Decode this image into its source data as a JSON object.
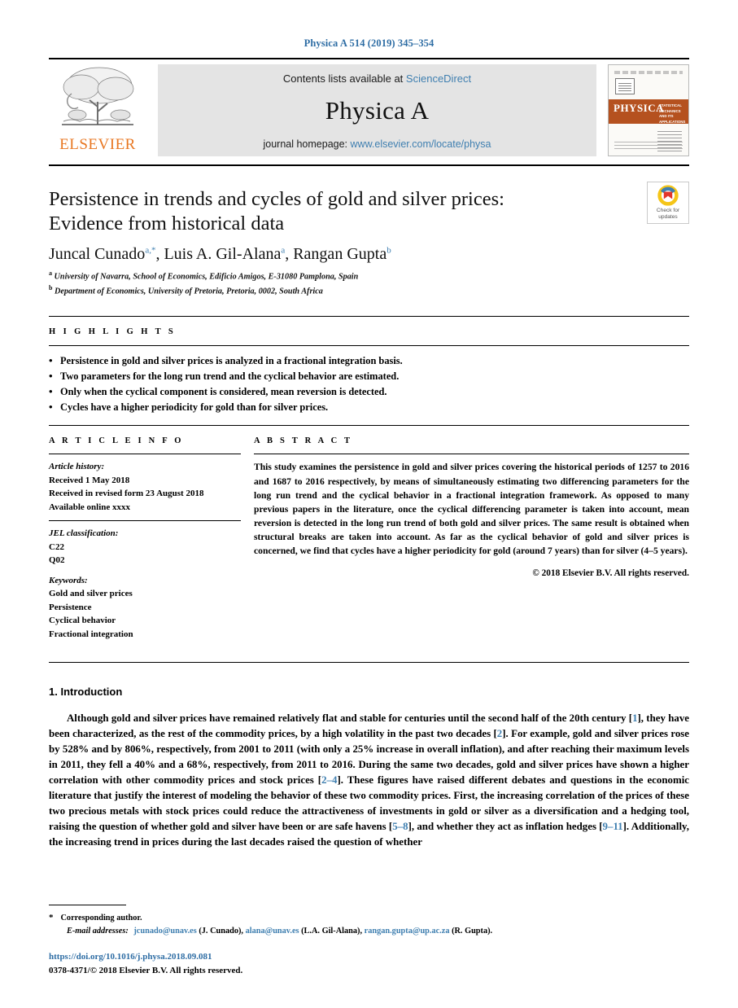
{
  "running_head": "Physica A 514 (2019) 345–354",
  "masthead": {
    "publisher_logo_name": "ELSEVIER",
    "contents_prefix": "Contents lists available at",
    "contents_link": "ScienceDirect",
    "journal_name": "Physica A",
    "homepage_prefix": "journal homepage:",
    "homepage_link": "www.elsevier.com/locate/physa",
    "cover": {
      "banner": "PHYSICA",
      "subtitle": "STATISTICAL MECHANICS AND ITS APPLICATIONS"
    }
  },
  "article": {
    "title_line1": "Persistence in trends and cycles of gold and silver prices:",
    "title_line2": "Evidence from historical data",
    "authors": [
      {
        "name": "Juncal Cunado",
        "marks": "a,*"
      },
      {
        "name": "Luis A. Gil-Alana",
        "marks": "a"
      },
      {
        "name": "Rangan Gupta",
        "marks": "b"
      }
    ],
    "affiliations": [
      {
        "mark": "a",
        "text": "University of Navarra, School of Economics, Edificio Amigos, E-31080  Pamplona, Spain"
      },
      {
        "mark": "b",
        "text": "Department of Economics, University of Pretoria, Pretoria, 0002, South Africa"
      }
    ],
    "crossmark": {
      "line1": "Check for",
      "line2": "updates"
    }
  },
  "highlights": {
    "heading": "H I G H L I G H T S",
    "items": [
      "Persistence in gold and silver prices is analyzed in a fractional integration basis.",
      "Two parameters for the long run trend and the cyclical behavior are estimated.",
      "Only when the cyclical component is considered, mean reversion is detected.",
      "Cycles have a higher periodicity for gold than for silver prices."
    ]
  },
  "article_info": {
    "heading": "A R T I C L E    I N F O",
    "history_title": "Article history:",
    "history": [
      "Received 1 May 2018",
      "Received in revised form 23 August 2018",
      "Available online  xxxx"
    ],
    "jel_title": "JEL classification:",
    "jel": [
      "C22",
      "Q02"
    ],
    "keywords_title": "Keywords:",
    "keywords": [
      "Gold and silver prices",
      "Persistence",
      "Cyclical behavior",
      "Fractional integration"
    ]
  },
  "abstract": {
    "heading": "A B S T R A C T",
    "text": "This study examines the persistence in gold and silver prices covering the historical periods of 1257 to 2016 and 1687 to 2016 respectively, by means of simultaneously estimating two differencing parameters for the long run trend and the cyclical behavior in a fractional integration framework. As opposed to many previous papers in the literature, once the cyclical differencing parameter is taken into account, mean reversion is detected in the long run trend of both gold and silver prices. The same result is obtained when structural breaks are taken into account. As far as the cyclical behavior of gold and silver prices is concerned, we find that cycles have a higher periodicity for gold (around 7 years) than for silver (4–5 years).",
    "copyright": "© 2018 Elsevier B.V. All rights reserved."
  },
  "body": {
    "section_number": "1.",
    "section_title": "Introduction",
    "paragraph_parts": [
      {
        "t": "Although gold and silver prices have remained relatively flat and stable for centuries until the second half of the 20th century ["
      },
      {
        "t": "1",
        "link": true
      },
      {
        "t": "], they have been characterized, as the rest of the commodity prices, by a high volatility in the past two decades ["
      },
      {
        "t": "2",
        "link": true
      },
      {
        "t": "]. For example, gold and silver prices rose by 528% and by 806%, respectively, from 2001 to 2011 (with only a 25% increase in overall inflation), and after reaching their maximum levels in 2011, they fell a 40% and a 68%, respectively, from 2011 to 2016. During the same two decades, gold and silver prices have shown a higher correlation with other commodity prices and stock prices ["
      },
      {
        "t": "2–4",
        "link": true
      },
      {
        "t": "]. These figures have raised different debates and questions in the economic literature that justify the interest of modeling the behavior of these two commodity prices. First, the increasing correlation of the prices of these two precious metals with stock prices could reduce the attractiveness of investments in gold or silver as a diversification and a hedging tool, raising the question of whether gold and silver have been or are safe havens ["
      },
      {
        "t": "5–8",
        "link": true
      },
      {
        "t": "], and whether they act as inflation hedges ["
      },
      {
        "t": "9–11",
        "link": true
      },
      {
        "t": "]. Additionally, the increasing trend in prices during the last decades raised the question of whether"
      }
    ]
  },
  "footnotes": {
    "corresponding_marker": "*",
    "corresponding_text": "Corresponding author.",
    "emails_label": "E-mail addresses:",
    "emails": [
      {
        "address": "jcunado@unav.es",
        "person": "(J. Cunado)"
      },
      {
        "address": "alana@unav.es",
        "person": "(L.A. Gil-Alana)"
      },
      {
        "address": "rangan.gupta@up.ac.za",
        "person": "(R. Gupta)"
      }
    ],
    "doi": "https://doi.org/10.1016/j.physa.2018.09.081",
    "issn": "0378-4371/© 2018 Elsevier B.V. All rights reserved."
  },
  "colors": {
    "link_blue": "#3f7fb0",
    "header_blue": "#2e6da4",
    "elsevier_orange": "#E87722",
    "masthead_gray": "#e4e4e4",
    "cover_band": "#b5511f"
  }
}
